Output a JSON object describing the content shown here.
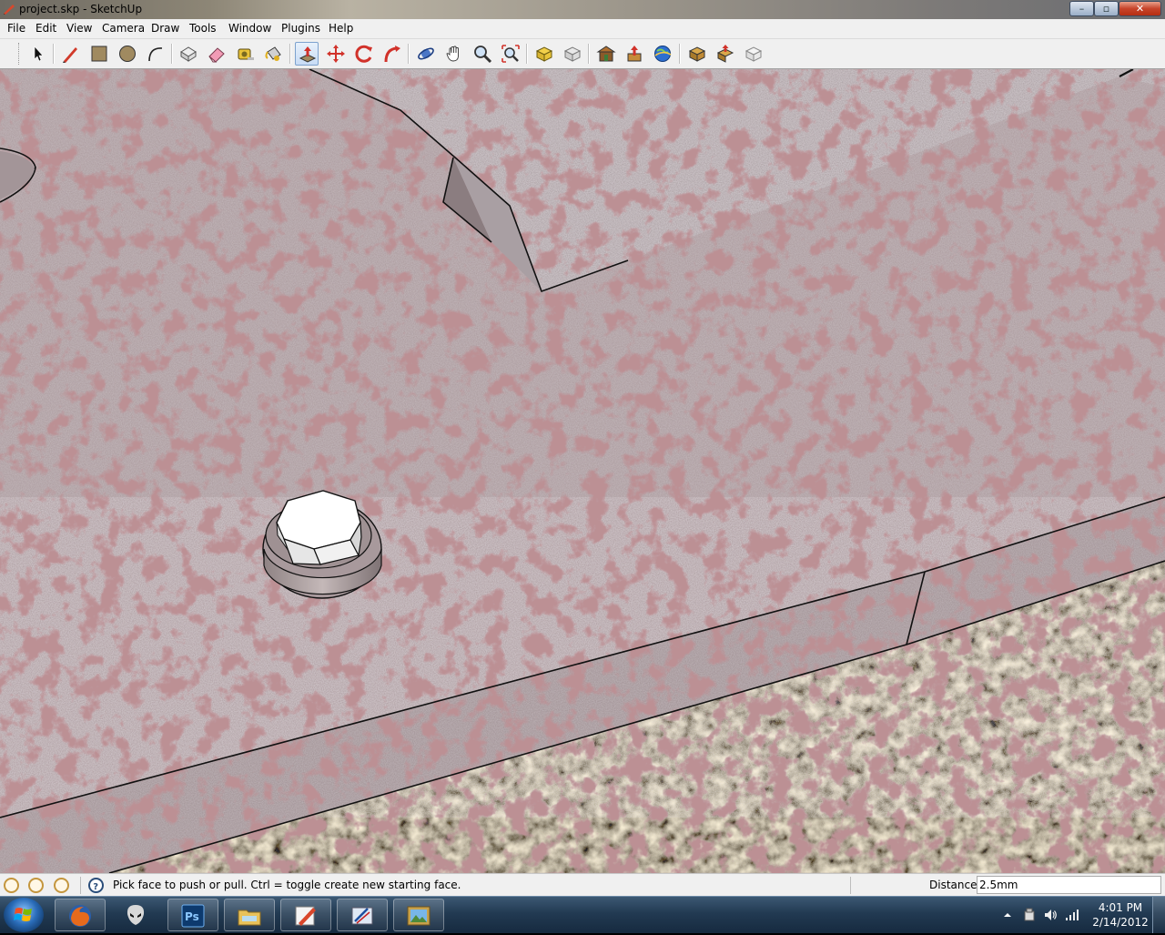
{
  "window": {
    "title": "project.skp - SketchUp",
    "controls": {
      "minimize": "–",
      "maximize": "▫",
      "close": "✕"
    }
  },
  "menu": [
    "File",
    "Edit",
    "View",
    "Camera",
    "Draw",
    "Tools",
    "Window",
    "Plugins",
    "Help"
  ],
  "toolbar": {
    "tools": [
      "select-tool",
      "line-tool",
      "rectangle-tool",
      "circle-tool",
      "arc-tool",
      "make-component-tool",
      "eraser-tool",
      "tape-measure-tool",
      "paint-bucket-tool",
      "push-pull-tool",
      "move-tool",
      "rotate-tool",
      "follow-me-tool",
      "orbit-tool",
      "pan-tool",
      "zoom-tool",
      "zoom-extents-tool",
      "previous-view-tool",
      "next-view-tool",
      "3d-warehouse-tool",
      "share-model-tool",
      "get-models-tool",
      "share-component-tool",
      "component-options-tool",
      "extension-warehouse-tool"
    ],
    "active_tool": "push-pull-tool"
  },
  "status": {
    "message": "Pick face to push or pull.  Ctrl = toggle create new starting face.",
    "measurement_label": "Distance",
    "measurement_value": "2.5mm"
  },
  "taskbar": {
    "apps": [
      "firefox",
      "alien-app",
      "photoshop",
      "windows-explorer",
      "sketchup",
      "drawing-app",
      "image-viewer"
    ],
    "clock_time": "4:01 PM",
    "clock_date": "2/14/2012"
  },
  "colors": {
    "stone_texture": "#a8979a",
    "granite_ground": "#6f6a5c",
    "hex_nut": "#ffffff",
    "active_tool_highlight": "#c8dcf5"
  }
}
